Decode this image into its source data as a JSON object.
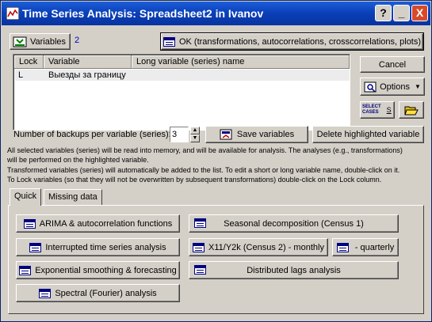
{
  "titlebar": {
    "title": "Time Series Analysis: Spreadsheet2 in Ivanov",
    "help_label": "?",
    "minimize_label": "_",
    "close_label": "X",
    "icon": "chart-icon"
  },
  "variables": {
    "button_label": "Variables",
    "count": "2"
  },
  "ok_button": {
    "label": "OK (transformations, autocorrelations, crosscorrelations, plots)"
  },
  "list": {
    "headers": [
      "Lock",
      "Variable",
      "Long variable (series) name"
    ],
    "rows": [
      {
        "lock": "L",
        "variable": "Выезды за границу",
        "long_name": ""
      }
    ]
  },
  "side": {
    "cancel_label": "Cancel",
    "options_label": "Options",
    "select_cases_label_1": "SELECT",
    "select_cases_label_2": "CASES",
    "select_cases_s": "S",
    "open_icon": "folder-open-icon"
  },
  "backups": {
    "label": "Number of backups per variable (series):",
    "value": "3",
    "save_label": "Save variables",
    "delete_label": "Delete highlighted variable"
  },
  "info": {
    "line1": "All selected variables (series) will be read into memory, and will be available for analysis. The analyses (e.g., transformations)",
    "line2": "will be performed on the highlighted variable.",
    "line3": "Transformed variables (series) will automatically be added to the list. To edit a short or long variable name, double-click on it.",
    "line4": "To Lock variables (so that they will not be overwritten by subsequent transformations) double-click on the Lock column."
  },
  "tabs": [
    {
      "label": "Quick"
    },
    {
      "label": "Missing data"
    }
  ],
  "quick": {
    "arima": "ARIMA & autocorrelation functions",
    "interrupted": "Interrupted time series analysis",
    "exponential": "Exponential smoothing & forecasting",
    "spectral": "Spectral (Fourier) analysis",
    "seasonal": "Seasonal decomposition (Census 1)",
    "x11_monthly": "X11/Y2k (Census 2) - monthly",
    "quarterly": "- quarterly",
    "distributed": "Distributed lags analysis"
  },
  "colors": {
    "titlebar": "#0a3fb8",
    "face": "#d4d0c8",
    "count": "#0000c0"
  }
}
